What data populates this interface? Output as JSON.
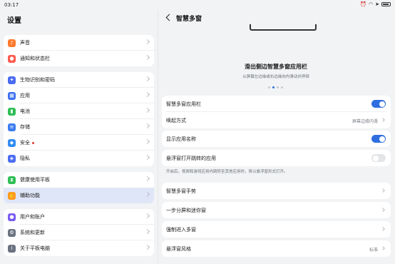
{
  "status": {
    "time": "03:17"
  },
  "left": {
    "title": "设置",
    "groups": [
      {
        "items": [
          {
            "label": "声音",
            "icon": "speaker-icon",
            "color": "#ff7a2e",
            "glyph": "♪"
          },
          {
            "label": "通知和状态栏",
            "icon": "bell-icon",
            "color": "#ff5a4e",
            "glyph": "●"
          }
        ]
      },
      {
        "items": [
          {
            "label": "生物识别和密码",
            "icon": "key-icon",
            "color": "#4a6cf0",
            "glyph": "✦"
          },
          {
            "label": "应用",
            "icon": "apps-icon",
            "color": "#3b6ff0",
            "glyph": "▦"
          },
          {
            "label": "电池",
            "icon": "battery-icon",
            "color": "#2fbe55",
            "glyph": "▮"
          },
          {
            "label": "存储",
            "icon": "storage-icon",
            "color": "#3b7cf0",
            "glyph": "≡"
          },
          {
            "label": "安全",
            "icon": "shield-icon",
            "color": "#2f8cf0",
            "glyph": "◆",
            "badge": true
          },
          {
            "label": "隐私",
            "icon": "lock-icon",
            "color": "#4a6cf0",
            "glyph": "◈"
          }
        ]
      },
      {
        "items": [
          {
            "label": "健康使用平板",
            "icon": "hourglass-icon",
            "color": "#2fbe55",
            "glyph": "⧗"
          },
          {
            "label": "辅助功能",
            "icon": "accessibility-icon",
            "color": "#ff9a1f",
            "glyph": "✋",
            "active": true
          }
        ]
      },
      {
        "items": [
          {
            "label": "用户和账户",
            "icon": "user-icon",
            "color": "#7a5cf0",
            "glyph": "●"
          },
          {
            "label": "系统和更新",
            "icon": "gear-icon",
            "color": "#6b7280",
            "glyph": "⚙"
          },
          {
            "label": "关于平板电脑",
            "icon": "info-icon",
            "color": "#6b7280",
            "glyph": "i"
          }
        ]
      }
    ]
  },
  "right": {
    "title": "智慧多窗",
    "feature": {
      "title": "滑出侧边智慧多窗应用栏",
      "subtitle": "从屏幕左边缘或右边缘向内滑动并停顿"
    },
    "items": {
      "smart_bar": {
        "label": "智慧多窗应用栏",
        "on": true
      },
      "invoke": {
        "label": "唤起方式",
        "value": "屏幕边缘内滑"
      },
      "show_names": {
        "label": "显示应用名称",
        "on": true
      },
      "floating_jump": {
        "label": "悬浮窗打开跳转的应用",
        "on": false
      },
      "hint": "开启后，视频和游戏应用内跳转至其他应用时，将以悬浮窗形式打开。",
      "gestures": {
        "label": "智慧多窗手势"
      },
      "split": {
        "label": "一步分屏和迷你窗"
      },
      "force": {
        "label": "强制进入多窗"
      },
      "style": {
        "label": "悬浮窗风格",
        "value": "标准"
      }
    }
  },
  "colors": {
    "accent": "#2f6de1",
    "active_bg": "#dfe6f7"
  }
}
